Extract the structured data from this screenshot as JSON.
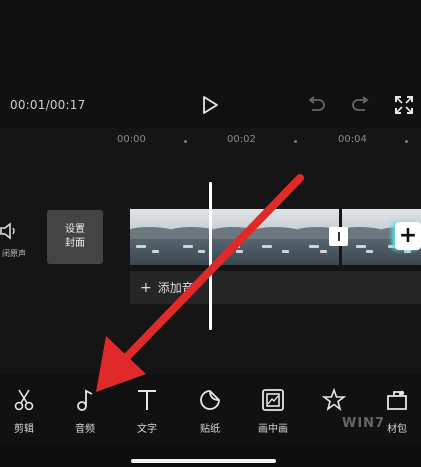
{
  "player": {
    "time": "00:01/00:17"
  },
  "timeline": {
    "ticks": [
      "00:00",
      "00:02",
      "00:04"
    ],
    "mute_label": "闭原声",
    "cover_label": "设置封面",
    "add_audio_label": "添加音",
    "add_audio_plus": "+",
    "add_clip_plus": "+"
  },
  "toolbar": {
    "items": [
      {
        "label": "剪辑",
        "icon": "scissors-icon"
      },
      {
        "label": "音频",
        "icon": "music-note-icon"
      },
      {
        "label": "文字",
        "icon": "text-icon"
      },
      {
        "label": "贴纸",
        "icon": "sticker-icon"
      },
      {
        "label": "画中画",
        "icon": "picture-in-picture-icon"
      },
      {
        "label": "",
        "icon": "effects-icon"
      },
      {
        "label": "材包",
        "icon": "material-pack-icon"
      }
    ]
  },
  "watermark": "WIN7",
  "colors": {
    "accent_cyan": "#58e3e3",
    "annotation_arrow": "#e02a2a"
  }
}
